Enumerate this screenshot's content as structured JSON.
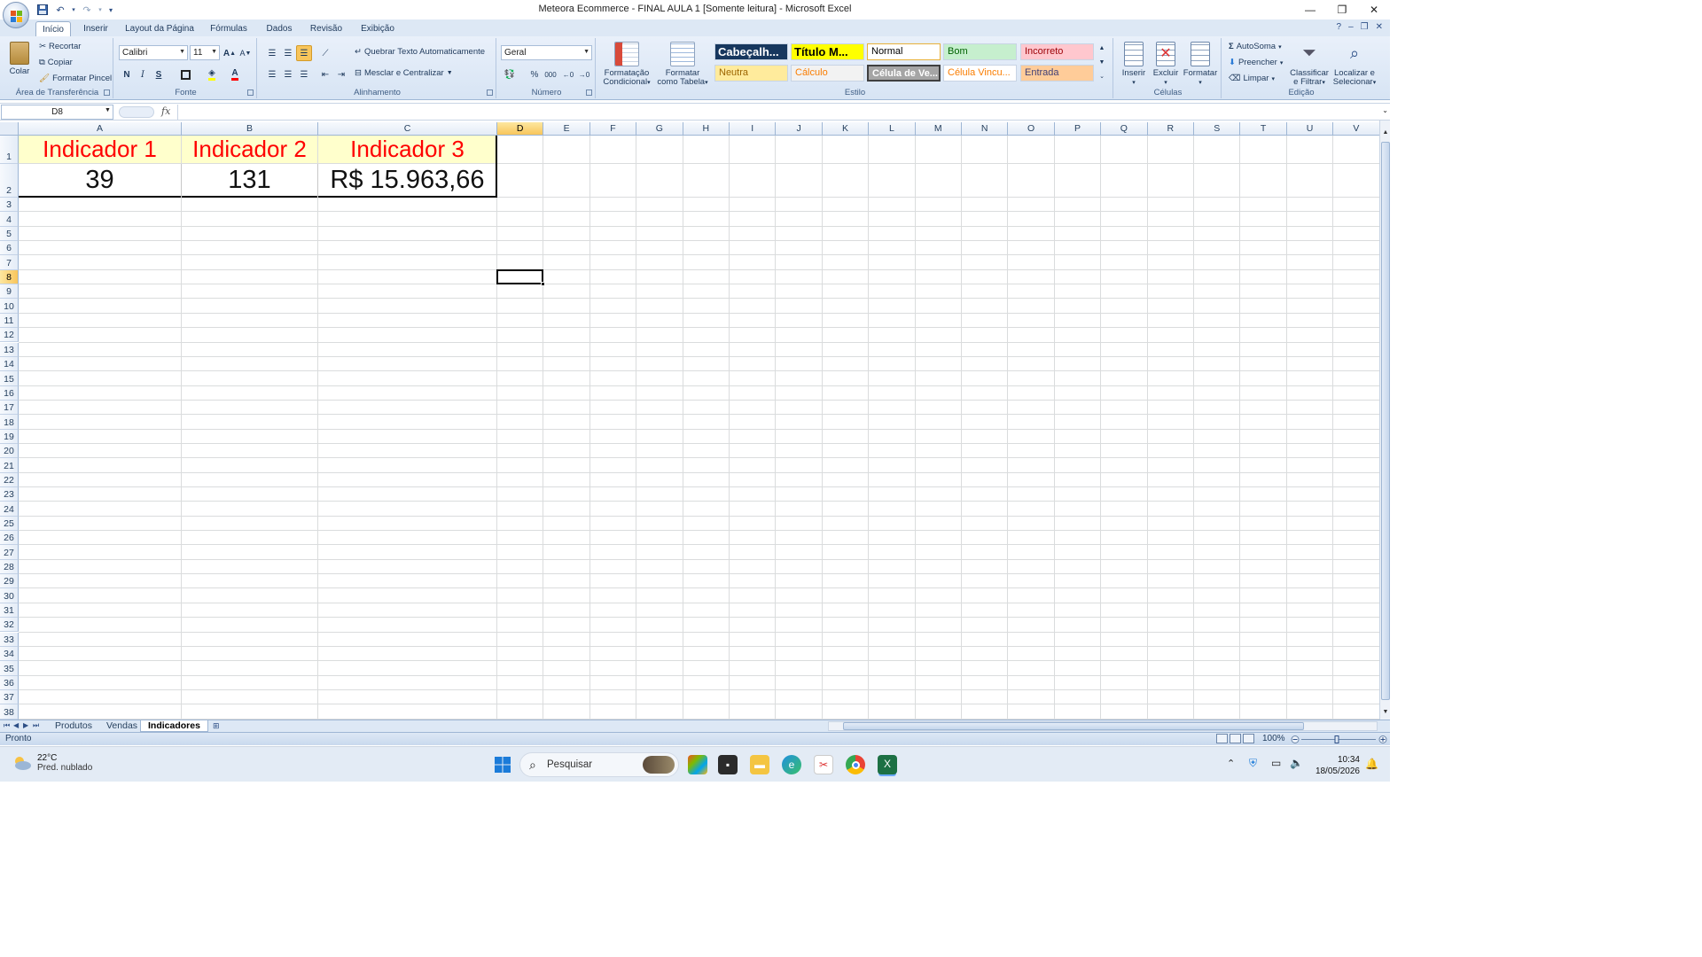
{
  "window": {
    "title": "Meteora Ecommerce - FINAL AULA 1  [Somente leitura] - Microsoft Excel"
  },
  "tabs": [
    "Início",
    "Inserir",
    "Layout da Página",
    "Fórmulas",
    "Dados",
    "Revisão",
    "Exibição"
  ],
  "ribbon": {
    "clipboard": {
      "label": "Área de Transferência",
      "paste": "Colar",
      "cut": "Recortar",
      "copy": "Copiar",
      "format_painter": "Formatar Pincel"
    },
    "font": {
      "label": "Fonte",
      "font_name": "Calibri",
      "font_size": "11",
      "bold": "N",
      "italic": "I",
      "underline": "S"
    },
    "alignment": {
      "label": "Alinhamento",
      "wrap": "Quebrar Texto Automaticamente",
      "merge": "Mesclar e Centralizar"
    },
    "number": {
      "label": "Número",
      "format": "Geral",
      "percent": "%",
      "thousands": "000"
    },
    "styles": {
      "label": "Estilo",
      "conditional": [
        "Formatação",
        "Condicional"
      ],
      "as_table": [
        "Formatar",
        "como Tabela"
      ],
      "cells": [
        {
          "text": "Cabeçalh...",
          "bg": "#17375e",
          "fg": "#ffffff"
        },
        {
          "text": "Título M...",
          "bg": "#ffff00",
          "fg": "#000000"
        },
        {
          "text": "Normal",
          "bg": "#ffffff",
          "fg": "#000000"
        },
        {
          "text": "Bom",
          "bg": "#c6efce",
          "fg": "#006100"
        },
        {
          "text": "Incorreto",
          "bg": "#ffc7ce",
          "fg": "#9c0006"
        },
        {
          "text": "Neutra",
          "bg": "#ffeb9c",
          "fg": "#9c6500"
        },
        {
          "text": "Cálculo",
          "bg": "#f2f2f2",
          "fg": "#fa7d00"
        },
        {
          "text": "Célula de Ve...",
          "bg": "#a5a5a5",
          "fg": "#ffffff"
        },
        {
          "text": "Célula Vincu...",
          "bg": "#ffffff",
          "fg": "#fa7d00"
        },
        {
          "text": "Entrada",
          "bg": "#ffcc99",
          "fg": "#3f3f76"
        }
      ]
    },
    "cells_group": {
      "label": "Células",
      "insert": "Inserir",
      "delete": "Excluir",
      "format": "Formatar"
    },
    "editing": {
      "label": "Edição",
      "autosum": "AutoSoma",
      "fill": "Preencher",
      "clear": "Limpar",
      "sort": [
        "Classificar",
        "e Filtrar"
      ],
      "find": [
        "Localizar e",
        "Selecionar"
      ]
    }
  },
  "formula_bar": {
    "name_box": "D8",
    "fx": "fx",
    "formula": ""
  },
  "grid": {
    "columns": [
      "A",
      "B",
      "C",
      "D",
      "E",
      "F",
      "G",
      "H",
      "I",
      "J",
      "K",
      "L",
      "M",
      "N",
      "O",
      "P",
      "Q",
      "R",
      "S",
      "T",
      "U",
      "V"
    ],
    "rows": [
      "1",
      "2",
      "3",
      "4",
      "5",
      "6",
      "7",
      "8",
      "9",
      "10",
      "11",
      "12",
      "13",
      "14",
      "15",
      "16",
      "17",
      "18",
      "19",
      "20",
      "21",
      "22",
      "23",
      "24",
      "25",
      "26",
      "27",
      "28",
      "29",
      "30",
      "31",
      "32",
      "33",
      "34",
      "35",
      "36",
      "37",
      "38"
    ],
    "selected_col": "D",
    "selected_row": "8",
    "cells": {
      "A1": "Indicador 1",
      "B1": "Indicador 2",
      "C1": "Indicador 3",
      "A2": "39",
      "B2": "131",
      "C2": "R$ 15.963,66"
    },
    "header_fill": "#ffffcc",
    "header_text_color": "#ff0000"
  },
  "sheets": [
    "Produtos",
    "Vendas",
    "Indicadores"
  ],
  "active_sheet": "Indicadores",
  "status": {
    "text": "Pronto",
    "zoom": "100%"
  },
  "taskbar": {
    "weather_temp": "22°C",
    "weather_desc": "Pred. nublado",
    "search_placeholder": "Pesquisar",
    "time": "10:34",
    "date": "18/05/2026"
  }
}
